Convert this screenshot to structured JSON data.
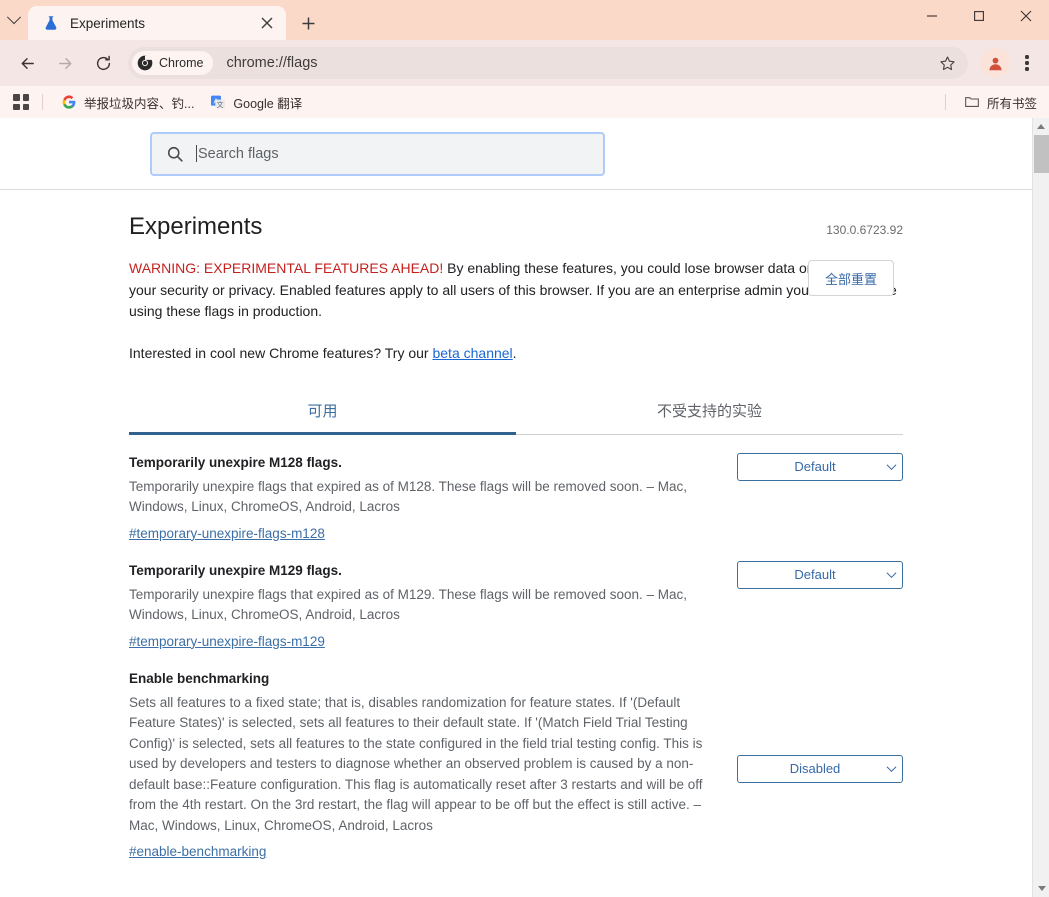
{
  "window": {
    "tab_list_icon": "chevron-down-icon",
    "minimize_label": "—",
    "maximize_label": "□",
    "close_label": "✕"
  },
  "tab": {
    "title": "Experiments",
    "favicon": "flask-icon",
    "close_icon": "close-icon",
    "new_tab_icon": "plus-icon"
  },
  "toolbar": {
    "back_icon": "arrow-left-icon",
    "forward_icon": "arrow-right-icon",
    "reload_icon": "reload-icon",
    "chrome_chip_label": "Chrome",
    "chrome_chip_icon": "chrome-logo-icon",
    "url": "chrome://flags",
    "bookmark_icon": "star-icon",
    "profile_icon": "avatar-icon",
    "menu_icon": "three-dots-icon"
  },
  "bookmarks_bar": {
    "apps_icon": "apps-grid-icon",
    "items": [
      {
        "label": "举报垃圾内容、钓...",
        "icon": "google-g-icon"
      },
      {
        "label": "Google 翻译",
        "icon": "google-translate-icon"
      }
    ],
    "all_bookmarks": {
      "label": "所有书签",
      "icon": "folder-icon"
    }
  },
  "flags_page": {
    "search": {
      "placeholder": "Search flags",
      "value": "",
      "icon": "search-icon"
    },
    "reset_all_label": "全部重置",
    "title": "Experiments",
    "version": "130.0.6723.92",
    "warning_strong": "WARNING: EXPERIMENTAL FEATURES AHEAD!",
    "warning_body": " By enabling these features, you could lose browser data or compromise your security or privacy. Enabled features apply to all users of this browser. If you are an enterprise admin you should not be using these flags in production.",
    "beta_prefix": "Interested in cool new Chrome features? Try our ",
    "beta_link": "beta channel",
    "beta_suffix": ".",
    "tabs": [
      {
        "label": "可用",
        "active": true
      },
      {
        "label": "不受支持的实验",
        "active": false
      }
    ],
    "flags": [
      {
        "name": "Temporarily unexpire M128 flags.",
        "description": "Temporarily unexpire flags that expired as of M128. These flags will be removed soon. – Mac, Windows, Linux, ChromeOS, Android, Lacros",
        "permalink": "#temporary-unexpire-flags-m128",
        "select_value": "Default"
      },
      {
        "name": "Temporarily unexpire M129 flags.",
        "description": "Temporarily unexpire flags that expired as of M129. These flags will be removed soon. – Mac, Windows, Linux, ChromeOS, Android, Lacros",
        "permalink": "#temporary-unexpire-flags-m129",
        "select_value": "Default"
      },
      {
        "name": "Enable benchmarking",
        "description": "Sets all features to a fixed state; that is, disables randomization for feature states. If '(Default Feature States)' is selected, sets all features to their default state. If '(Match Field Trial Testing Config)' is selected, sets all features to the state configured in the field trial testing config. This is used by developers and testers to diagnose whether an observed problem is caused by a non-default base::Feature configuration. This flag is automatically reset after 3 restarts and will be off from the 4th restart. On the 3rd restart, the flag will appear to be off but the effect is still active. – Mac, Windows, Linux, ChromeOS, Android, Lacros",
        "permalink": "#enable-benchmarking",
        "select_value": "Disabled"
      }
    ]
  },
  "scrollbar": {
    "up_icon": "triangle-up-icon",
    "down_icon": "triangle-down-icon"
  },
  "colors": {
    "titlebar": "#fbd9c8",
    "toolbar": "#f3e6e4",
    "bookmarks": "#fdf3f0",
    "accent_blue": "#3769a8",
    "warning_red": "#c5221f",
    "link_blue": "#1967d2"
  }
}
